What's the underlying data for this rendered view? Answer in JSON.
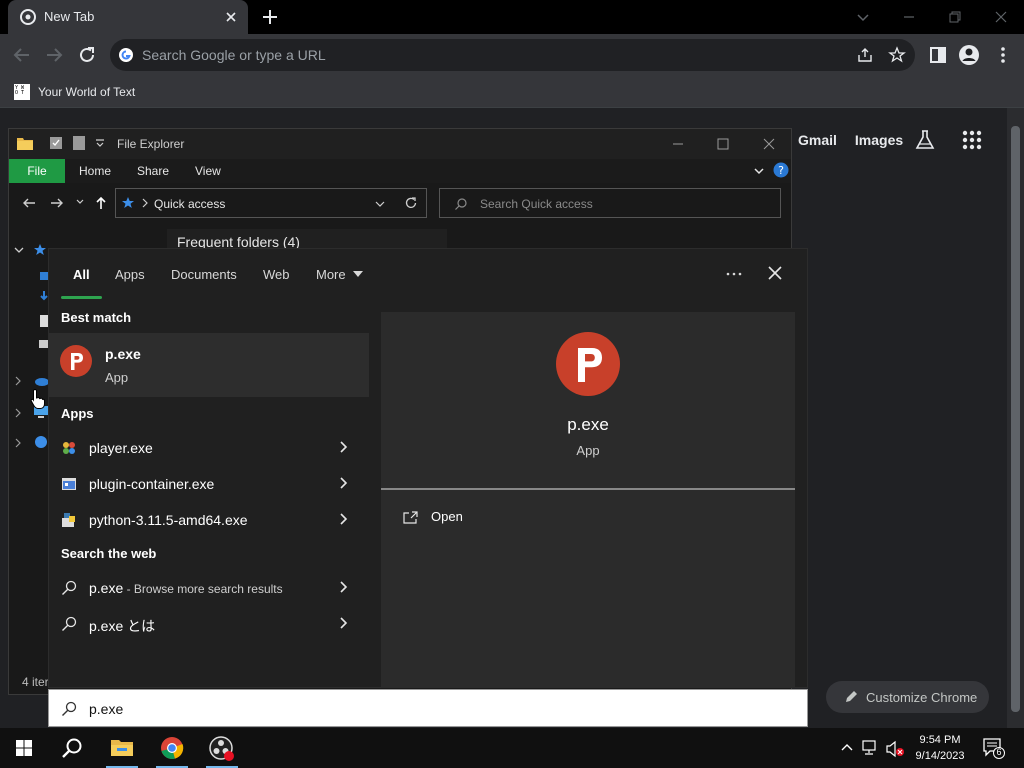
{
  "chrome": {
    "tab_title": "New Tab",
    "omnibox_placeholder": "Search Google or type a URL",
    "bookmark_label": "Your World of Text",
    "bookmark_icon_text": "Y W O T",
    "ntp_links": [
      "Gmail",
      "Images"
    ],
    "customize_label": "Customize Chrome"
  },
  "explorer": {
    "title": "File Explorer",
    "ribbon_tabs": [
      "File",
      "Home",
      "Share",
      "View"
    ],
    "address": "Quick access",
    "search_placeholder": "Search Quick access",
    "frequent_header": "Frequent folders (4)",
    "status": "4 iter"
  },
  "search": {
    "tabs": [
      "All",
      "Apps",
      "Documents",
      "Web",
      "More"
    ],
    "best_match_header": "Best match",
    "best_match": {
      "name": "p.exe",
      "type": "App"
    },
    "apps_header": "Apps",
    "apps": [
      {
        "name": "player.exe"
      },
      {
        "name": "plugin-container.exe"
      },
      {
        "name": "python-3.11.5-amd64.exe"
      }
    ],
    "web_header": "Search the web",
    "web_results": [
      {
        "name": "p.exe",
        "suffix": " - Browse more search results"
      },
      {
        "name": "p.exe とは",
        "suffix": ""
      }
    ],
    "preview": {
      "name": "p.exe",
      "type": "App",
      "action": "Open"
    },
    "query": "p.exe"
  },
  "taskbar": {
    "time": "9:54 PM",
    "date": "9/14/2023",
    "notification_count": "6"
  },
  "colors": {
    "accent_green": "#2ea44f",
    "psiphon_red": "#c8402a",
    "taskbar_active": "#76b9ed"
  }
}
